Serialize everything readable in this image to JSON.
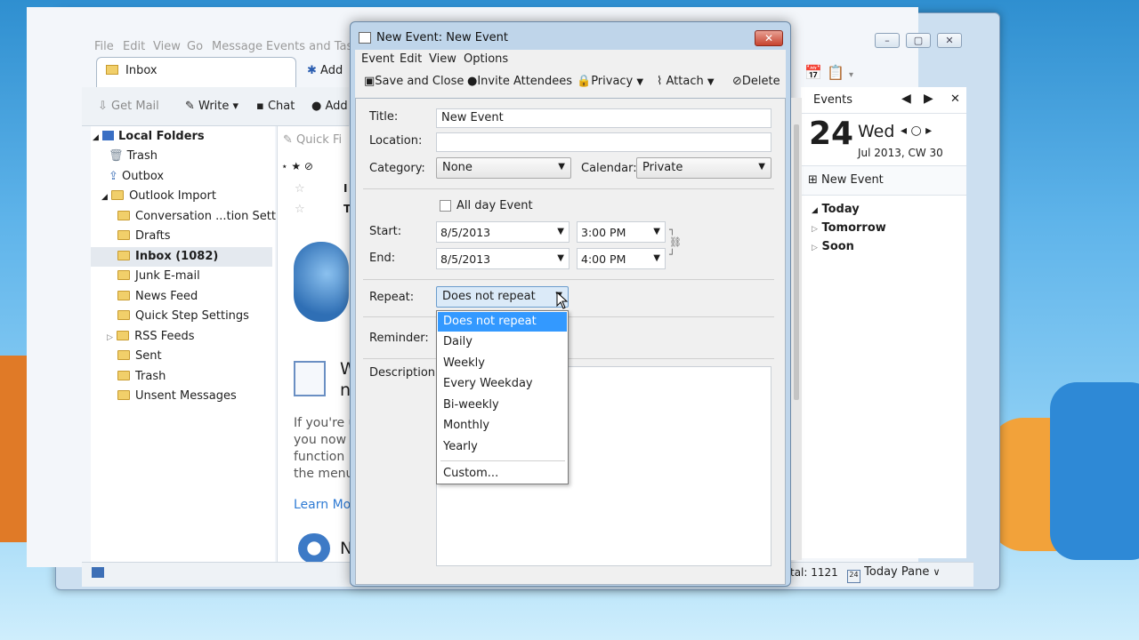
{
  "main_window": {
    "menu": [
      "File",
      "Edit",
      "View",
      "Go",
      "Message",
      "Events and Tasks"
    ],
    "tab_inbox": "Inbox",
    "tab_add": "Add",
    "toolbar": {
      "get_mail": "Get Mail",
      "write": "Write",
      "chat": "Chat",
      "address": "Add"
    },
    "quick_filter": "Quick Fi",
    "message_rows": [
      "I",
      "T"
    ],
    "folders": [
      "Local Folders",
      "Trash",
      "Outbox",
      "Outlook Import",
      "Conversation ...tion Settings",
      "Drafts",
      "Inbox (1082)",
      "Junk E-mail",
      "News Feed",
      "Quick Step Settings",
      "RSS Feeds",
      "Sent",
      "Trash",
      "Unsent Messages"
    ],
    "start_page": {
      "heading_frag1": "W",
      "heading_frag2": "n",
      "para": [
        "If you're u",
        "you now f",
        "function",
        "the menu"
      ],
      "learn_more": "Learn Mo",
      "section2_frag": "N"
    },
    "status": {
      "total": "tal: 1121",
      "today_pane": "Today Pane"
    }
  },
  "today_pane": {
    "title": "Events",
    "day_num": "24",
    "day_name": "Wed",
    "month_week": "Jul 2013, CW 30",
    "new_event": "New Event",
    "groups": [
      "Today",
      "Tomorrow",
      "Soon"
    ],
    "calendar_icon_day": "24"
  },
  "dialog": {
    "title": "New Event: New Event",
    "menu": [
      "Event",
      "Edit",
      "View",
      "Options"
    ],
    "toolbar": {
      "save_close": "Save and Close",
      "invite": "Invite Attendees",
      "privacy": "Privacy",
      "attach": "Attach",
      "delete": "Delete"
    },
    "labels": {
      "title": "Title:",
      "location": "Location:",
      "category": "Category:",
      "calendar": "Calendar:",
      "all_day": "All day Event",
      "start": "Start:",
      "end": "End:",
      "repeat": "Repeat:",
      "reminder": "Reminder:",
      "description": "Description:"
    },
    "values": {
      "title": "New Event",
      "location": "",
      "category": "None",
      "calendar": "Private",
      "start_date": "8/5/2013",
      "start_time": "3:00 PM",
      "end_date": "8/5/2013",
      "end_time": "4:00 PM",
      "repeat": "Does not repeat"
    },
    "repeat_options": [
      "Does not repeat",
      "Daily",
      "Weekly",
      "Every Weekday",
      "Bi-weekly",
      "Monthly",
      "Yearly",
      "Custom..."
    ]
  },
  "colors": {
    "highlight": "#3399ff",
    "folder": "#f1cf6a"
  }
}
